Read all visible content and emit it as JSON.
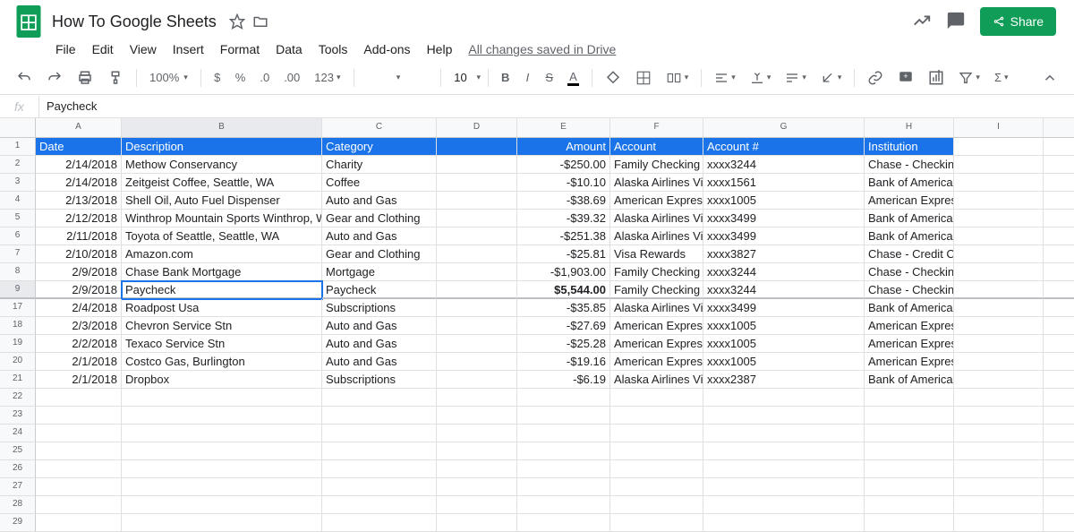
{
  "doc_title": "How To Google Sheets",
  "save_status": "All changes saved in Drive",
  "share_label": "Share",
  "menubar": [
    "File",
    "Edit",
    "View",
    "Insert",
    "Format",
    "Data",
    "Tools",
    "Add-ons",
    "Help"
  ],
  "toolbar": {
    "zoom": "100%",
    "font_size": "10",
    "number_format": "123"
  },
  "formula_bar": {
    "label": "fx",
    "value": "Paycheck"
  },
  "active_cell": "B9",
  "columns": [
    "A",
    "B",
    "C",
    "D",
    "E",
    "F",
    "G",
    "H",
    "I",
    ""
  ],
  "row_numbers": [
    "1",
    "2",
    "3",
    "4",
    "5",
    "6",
    "7",
    "8",
    "9",
    "17",
    "18",
    "19",
    "20",
    "21",
    "22",
    "23",
    "24",
    "25",
    "26",
    "27",
    "28",
    "29"
  ],
  "headers": [
    "Date",
    "Description",
    "Category",
    "",
    "Amount",
    "Account",
    "Account #",
    "Institution"
  ],
  "rows": [
    {
      "date": "2/14/2018",
      "desc": "Methow Conservancy",
      "cat": "Charity",
      "amt": "-$250.00",
      "acct": "Family Checking",
      "num": "xxxx3244",
      "inst": "Chase - Checking"
    },
    {
      "date": "2/14/2018",
      "desc": "Zeitgeist Coffee, Seattle, WA",
      "cat": "Coffee",
      "amt": "-$10.10",
      "acct": "Alaska Airlines Visa",
      "num": "xxxx1561",
      "inst": "Bank of America - Credit Card"
    },
    {
      "date": "2/13/2018",
      "desc": "Shell Oil, Auto Fuel Dispenser",
      "cat": "Auto and Gas",
      "amt": "-$38.69",
      "acct": "American Express",
      "num": "xxxx1005",
      "inst": "American Express Cards"
    },
    {
      "date": "2/12/2018",
      "desc": "Winthrop Mountain Sports Winthrop, WA",
      "cat": "Gear and Clothing",
      "amt": "-$39.32",
      "acct": "Alaska Airlines Visa",
      "num": "xxxx3499",
      "inst": "Bank of America - Credit Card"
    },
    {
      "date": "2/11/2018",
      "desc": "Toyota of Seattle, Seattle, WA",
      "cat": "Auto and Gas",
      "amt": "-$251.38",
      "acct": "Alaska Airlines Visa",
      "num": "xxxx3499",
      "inst": "Bank of America - Credit Card"
    },
    {
      "date": "2/10/2018",
      "desc": "Amazon.com",
      "cat": "Gear and Clothing",
      "amt": "-$25.81",
      "acct": "Visa Rewards",
      "num": "xxxx3827",
      "inst": "Chase - Credit Card"
    },
    {
      "date": "2/9/2018",
      "desc": "Chase Bank Mortgage",
      "cat": "Mortgage",
      "amt": "-$1,903.00",
      "acct": "Family Checking",
      "num": "xxxx3244",
      "inst": "Chase - Checking"
    },
    {
      "date": "2/9/2018",
      "desc": "Paycheck",
      "cat": "Paycheck",
      "amt": "$5,544.00",
      "acct": "Family Checking",
      "num": "xxxx3244",
      "inst": "Chase - Checking",
      "bold": true,
      "active": true
    },
    {
      "date": "2/4/2018",
      "desc": "Roadpost Usa",
      "cat": "Subscriptions",
      "amt": "-$35.85",
      "acct": "Alaska Airlines Visa",
      "num": "xxxx3499",
      "inst": "Bank of America - Credit Card"
    },
    {
      "date": "2/3/2018",
      "desc": "Chevron Service Stn",
      "cat": "Auto and Gas",
      "amt": "-$27.69",
      "acct": "American Express",
      "num": "xxxx1005",
      "inst": "American Express Cards"
    },
    {
      "date": "2/2/2018",
      "desc": "Texaco Service Stn",
      "cat": "Auto and Gas",
      "amt": "-$25.28",
      "acct": "American Express",
      "num": "xxxx1005",
      "inst": "American Express Cards"
    },
    {
      "date": "2/1/2018",
      "desc": "Costco Gas, Burlington",
      "cat": "Auto and Gas",
      "amt": "-$19.16",
      "acct": "American Express",
      "num": "xxxx1005",
      "inst": "American Express Cards"
    },
    {
      "date": "2/1/2018",
      "desc": "Dropbox",
      "cat": "Subscriptions",
      "amt": "-$6.19",
      "acct": "Alaska Airlines Visa",
      "num": "xxxx2387",
      "inst": "Bank of America - Credit Card"
    }
  ]
}
